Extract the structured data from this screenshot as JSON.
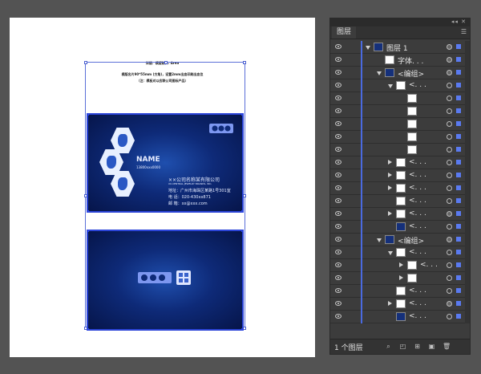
{
  "document": {
    "header_line1": "详细：横版制作. Area",
    "header_line2": "横版名片90*55mm (方角)，设置2mm出血印刷出血位",
    "header_line3": "（注：模板对以应联公司图标产品）",
    "card_front": {
      "name": "NAME",
      "phone": "13800xxx0000",
      "company_cn": "××公司名称某有限公司",
      "company_en": "XX.CENTRAL JEWELRY BRANDS, INC.",
      "address": "地址：广州市海珠区某路1号301室",
      "tel": "电 话：020-430xx871",
      "email": "邮 箱：xx@xxx.com"
    }
  },
  "layers_panel": {
    "tab_label": "图层",
    "menu_icon": "panel-menu-icon",
    "top_controls": "◂◂ ✕",
    "footer_count": "1 个图层",
    "rows": [
      {
        "label": "图层 1",
        "indent": 0,
        "arrow": "down",
        "thumb": "dark",
        "target": "filled",
        "select": "on"
      },
      {
        "label": "字体. . .",
        "indent": 1,
        "arrow": "",
        "thumb": "light",
        "target": "filled",
        "select": "on"
      },
      {
        "label": "<编组>",
        "indent": 1,
        "arrow": "down",
        "thumb": "dark",
        "target": "filled",
        "select": "on"
      },
      {
        "label": "<. . .",
        "indent": 2,
        "arrow": "down",
        "thumb": "light",
        "target": "",
        "select": "on"
      },
      {
        "label": "",
        "indent": 3,
        "arrow": "",
        "thumb": "light",
        "target": "",
        "select": "on"
      },
      {
        "label": "",
        "indent": 3,
        "arrow": "",
        "thumb": "light",
        "target": "",
        "select": "on"
      },
      {
        "label": "",
        "indent": 3,
        "arrow": "",
        "thumb": "light",
        "target": "",
        "select": "on"
      },
      {
        "label": "",
        "indent": 3,
        "arrow": "",
        "thumb": "light",
        "target": "",
        "select": "on"
      },
      {
        "label": "",
        "indent": 3,
        "arrow": "",
        "thumb": "light",
        "target": "",
        "select": "on"
      },
      {
        "label": "<. . .",
        "indent": 2,
        "arrow": "right",
        "thumb": "light",
        "target": "",
        "select": "on"
      },
      {
        "label": "<. . .",
        "indent": 2,
        "arrow": "right",
        "thumb": "light",
        "target": "",
        "select": "on"
      },
      {
        "label": "<. . .",
        "indent": 2,
        "arrow": "right",
        "thumb": "light",
        "target": "",
        "select": "on"
      },
      {
        "label": "<. . .",
        "indent": 2,
        "arrow": "",
        "thumb": "light",
        "target": "",
        "select": "on"
      },
      {
        "label": "<. . .",
        "indent": 2,
        "arrow": "right",
        "thumb": "light",
        "target": "filled",
        "select": "on"
      },
      {
        "label": "<. . .",
        "indent": 2,
        "arrow": "",
        "thumb": "dark",
        "target": "",
        "select": "on"
      },
      {
        "label": "<编组>",
        "indent": 1,
        "arrow": "down",
        "thumb": "dark",
        "target": "filled",
        "select": "on"
      },
      {
        "label": "<. . .",
        "indent": 2,
        "arrow": "down",
        "thumb": "light",
        "target": "",
        "select": "on"
      },
      {
        "label": "<. . .",
        "indent": 3,
        "arrow": "right",
        "thumb": "light",
        "target": "",
        "select": "on"
      },
      {
        "label": "",
        "indent": 3,
        "arrow": "right",
        "thumb": "light",
        "target": "",
        "select": "on"
      },
      {
        "label": "<. . .",
        "indent": 2,
        "arrow": "",
        "thumb": "light",
        "target": "",
        "select": "on"
      },
      {
        "label": "<. . .",
        "indent": 2,
        "arrow": "right",
        "thumb": "light",
        "target": "filled",
        "select": "on"
      },
      {
        "label": "<. . .",
        "indent": 2,
        "arrow": "",
        "thumb": "dark",
        "target": "",
        "select": "on"
      }
    ]
  },
  "colors": {
    "workspace": "#535353",
    "card_border": "#2b44d8",
    "layer_color": "#4a6ae0"
  }
}
